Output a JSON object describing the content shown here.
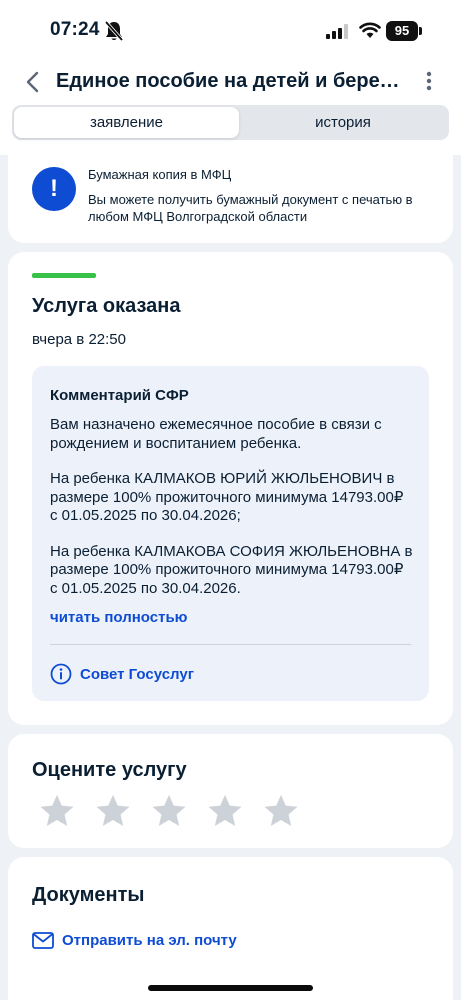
{
  "status_bar": {
    "time": "07:24",
    "battery": "95"
  },
  "header": {
    "title": "Единое пособие на детей и берем...",
    "tabs": [
      {
        "label": "заявление",
        "active": true
      },
      {
        "label": "история",
        "active": false
      }
    ]
  },
  "info_card": {
    "title": "Бумажная копия в МФЦ",
    "text": "Вы можете получить бумажный документ с печатью в любом МФЦ Волгоградской области",
    "icon_glyph": "!"
  },
  "status_card": {
    "title": "Услуга оказана",
    "date": "вчера в 22:50",
    "comment": {
      "title": "Комментарий СФР",
      "paragraphs": [
        "Вам назначено ежемесячное пособие в связи с рождением и воспитанием ребенка.",
        "На ребенка КАЛМАКОВ ЮРИЙ ЖЮЛЬЕНОВИЧ в размере 100% прожиточного минимума 14793.00₽ с 01.05.2025 по 30.04.2026;",
        "На ребенка КАЛМАКОВА СОФИЯ ЖЮЛЬЕНОВНА в размере 100% прожиточного минимума 14793.00₽ с 01.05.2025 по 30.04.2026."
      ],
      "read_more": "читать полностью",
      "advice_link": "Совет Госуслуг"
    }
  },
  "rating_card": {
    "title": "Оцените услугу",
    "stars_total": 5,
    "stars_selected": 0
  },
  "documents_card": {
    "title": "Документы",
    "email_link": "Отправить на эл. почту"
  },
  "colors": {
    "accent": "#0d4cd3",
    "success": "#38c24a",
    "star": "#cdd2d9",
    "comment_bg": "#edf2fa"
  }
}
